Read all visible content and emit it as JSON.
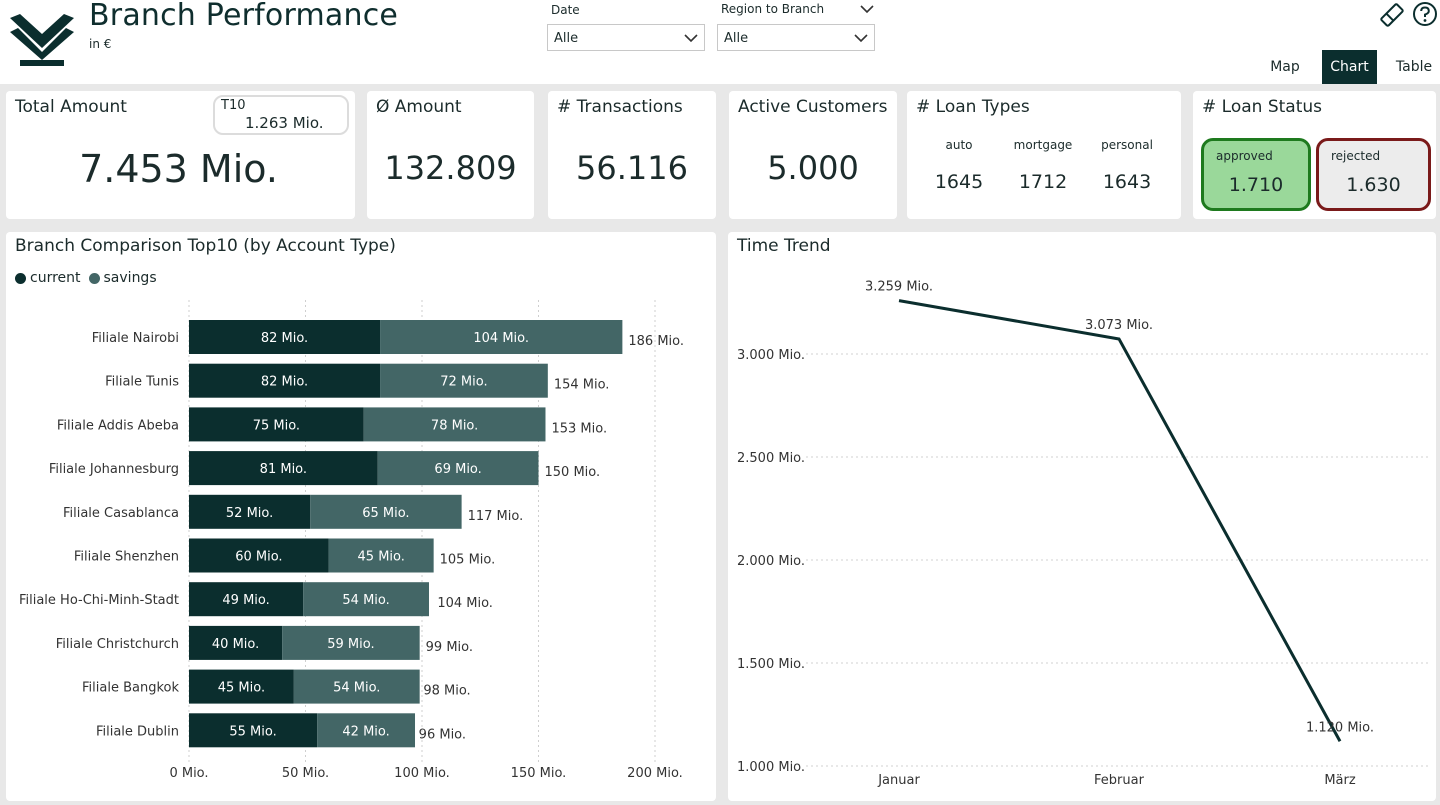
{
  "header": {
    "title": "Branch Performance",
    "subtitle": "in €",
    "date_slicer": {
      "label": "Date",
      "value": "Alle"
    },
    "region_slicer": {
      "label": "Region to Branch",
      "value": "Alle"
    },
    "toggles": [
      "Map",
      "Chart",
      "Table"
    ],
    "active_toggle": "Chart"
  },
  "kpis": {
    "total_amount": {
      "label": "Total Amount",
      "value": "7.453 Mio.",
      "t10_label": "T10",
      "t10_value": "1.263 Mio."
    },
    "avg_amount": {
      "label": "Ø Amount",
      "value": "132.809"
    },
    "transactions": {
      "label": "# Transactions",
      "value": "56.116"
    },
    "active_customers": {
      "label": "Active Customers",
      "value": "5.000"
    },
    "loan_types": {
      "label": "# Loan Types",
      "items": [
        {
          "name": "auto",
          "value": "1645"
        },
        {
          "name": "mortgage",
          "value": "1712"
        },
        {
          "name": "personal",
          "value": "1643"
        }
      ]
    },
    "loan_status": {
      "label": "# Loan Status",
      "approved": {
        "name": "approved",
        "value": "1.710"
      },
      "rejected": {
        "name": "rejected",
        "value": "1.630"
      }
    }
  },
  "chart_data": [
    {
      "type": "bar",
      "orientation": "horizontal",
      "stacked": true,
      "title": "Branch Comparison Top10 (by Account Type)",
      "legend_position": "top-left",
      "categories": [
        "Filiale Nairobi",
        "Filiale Tunis",
        "Filiale Addis Abeba",
        "Filiale Johannesburg",
        "Filiale Casablanca",
        "Filiale Shenzhen",
        "Filiale Ho-Chi-Minh-Stadt",
        "Filiale Christchurch",
        "Filiale Bangkok",
        "Filiale Dublin"
      ],
      "series": [
        {
          "name": "current",
          "color": "#0b2e2e",
          "values": [
            82,
            82,
            75,
            81,
            52,
            60,
            49,
            40,
            45,
            55
          ]
        },
        {
          "name": "savings",
          "color": "#436666",
          "values": [
            104,
            72,
            78,
            69,
            65,
            45,
            54,
            59,
            54,
            42
          ]
        }
      ],
      "totals": [
        186,
        154,
        153,
        150,
        117,
        105,
        104,
        99,
        98,
        96
      ],
      "unit": "Mio.",
      "xlim": [
        0,
        200
      ],
      "xticks": [
        0,
        50,
        100,
        150,
        200
      ],
      "grid": true
    },
    {
      "type": "line",
      "title": "Time Trend",
      "x": [
        "Januar",
        "Februar",
        "März"
      ],
      "series": [
        {
          "color": "#0b2e2e",
          "values": [
            3.259,
            3.073,
            1.12
          ]
        }
      ],
      "data_labels": [
        "3.259 Mio.",
        "3.073 Mio.",
        "1.120 Mio."
      ],
      "unit": "Mio.",
      "ylim": [
        1.0,
        3.3
      ],
      "yticks": [
        1.0,
        1.5,
        2.0,
        2.5,
        3.0
      ],
      "ytick_labels": [
        "1.000 Mio.",
        "1.500 Mio.",
        "2.000 Mio.",
        "2.500 Mio.",
        "3.000 Mio."
      ],
      "grid": true
    }
  ]
}
